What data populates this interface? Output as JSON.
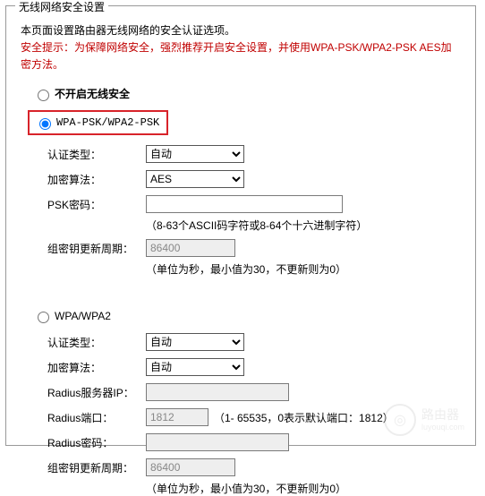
{
  "panel": {
    "title": "无线网络安全设置"
  },
  "intro": "本页面设置路由器无线网络的安全认证选项。",
  "warning": "安全提示：为保障网络安全，强烈推荐开启安全设置，并使用WPA-PSK/WPA2-PSK AES加密方法。",
  "security_mode": {
    "none_label": "不开启无线安全",
    "wpa_psk_label": "WPA-PSK/WPA2-PSK",
    "wpa_label": "WPA/WPA2",
    "selected": "wpa_psk"
  },
  "wpa_psk": {
    "auth_type_label": "认证类型：",
    "auth_type_value": "自动",
    "auth_type_options": [
      "自动"
    ],
    "cipher_label": "加密算法：",
    "cipher_value": "AES",
    "cipher_options": [
      "AES"
    ],
    "psk_label": "PSK密码：",
    "psk_value": "",
    "psk_hint": "（8-63个ASCII码字符或8-64个十六进制字符）",
    "cycle_label": "组密钥更新周期：",
    "cycle_value": "86400",
    "cycle_hint": "（单位为秒，最小值为30，不更新则为0）"
  },
  "wpa": {
    "auth_type_label": "认证类型：",
    "auth_type_value": "自动",
    "auth_type_options": [
      "自动"
    ],
    "cipher_label": "加密算法：",
    "cipher_value": "自动",
    "cipher_options": [
      "自动"
    ],
    "radius_ip_label": "Radius服务器IP：",
    "radius_ip_value": "",
    "radius_port_label": "Radius端口：",
    "radius_port_value": "1812",
    "radius_port_hint": "（1- 65535，0表示默认端口：1812）",
    "radius_pwd_label": "Radius密码：",
    "radius_pwd_value": "",
    "cycle_label": "组密钥更新周期：",
    "cycle_value": "86400",
    "cycle_hint": "（单位为秒，最小值为30，不更新则为0）"
  },
  "watermark": {
    "title": "路由器",
    "sub": "luyouqi.com"
  }
}
